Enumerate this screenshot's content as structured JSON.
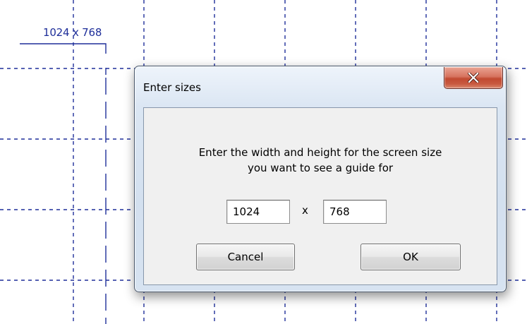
{
  "guide": {
    "label": "1024 x 768"
  },
  "dialog": {
    "title": "Enter sizes",
    "close_icon": "close-x-icon",
    "prompt_line1": "Enter the width and height for the screen size",
    "prompt_line2": "you want to see a guide for",
    "width_value": "1024",
    "separator": "x",
    "height_value": "768",
    "cancel_label": "Cancel",
    "ok_label": "OK"
  },
  "colors": {
    "guide_lines": "#1f2f9a",
    "close_button": "#c14a31",
    "client_background": "#f0f0f0"
  }
}
